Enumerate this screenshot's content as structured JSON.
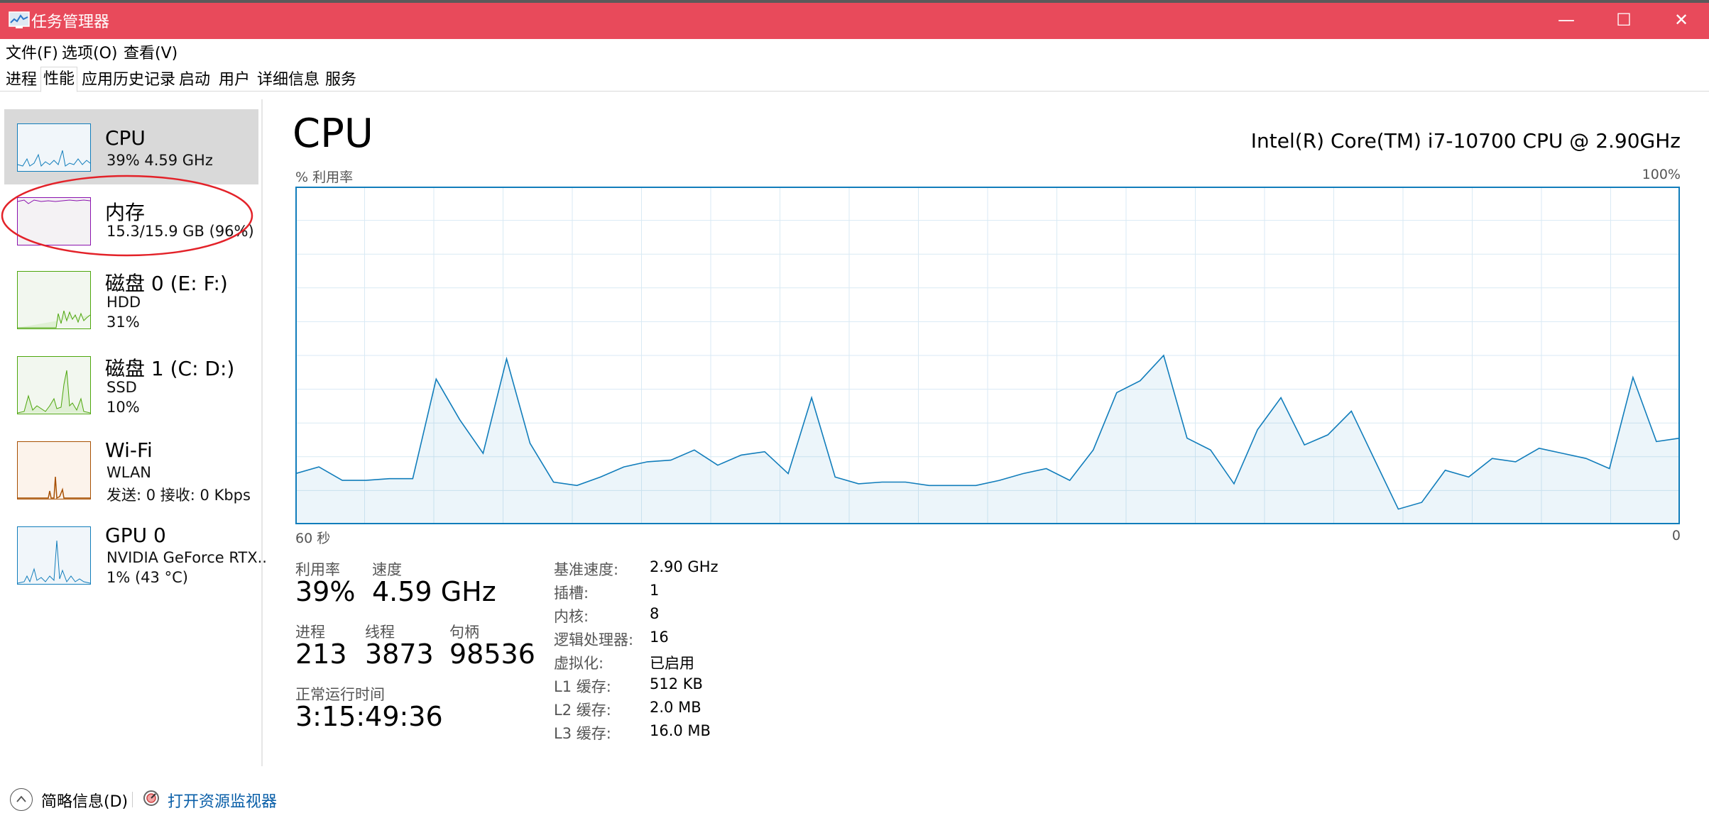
{
  "window": {
    "title": "任务管理器",
    "accent_color": "#e84a5b"
  },
  "window_controls": {
    "minimize": "—",
    "maximize": "☐",
    "close": "✕"
  },
  "menu": [
    "文件(F)",
    "选项(O)",
    "查看(V)"
  ],
  "tabs": [
    {
      "label": "进程"
    },
    {
      "label": "性能",
      "active": true
    },
    {
      "label": "应用历史记录"
    },
    {
      "label": "启动"
    },
    {
      "label": "用户"
    },
    {
      "label": "详细信息"
    },
    {
      "label": "服务"
    }
  ],
  "resources": [
    {
      "title": "CPU",
      "line1": "39%  4.59 GHz",
      "line2": "",
      "active": true,
      "color": "#117dbb"
    },
    {
      "title": "内存",
      "line1": "15.3/15.9 GB (96%)",
      "line2": "",
      "color": "#8b12ae",
      "annotation": "red-ellipse"
    },
    {
      "title": "磁盘 0 (E: F:)",
      "line1": "HDD",
      "line2": "31%",
      "color": "#4da60c"
    },
    {
      "title": "磁盘 1 (C: D:)",
      "line1": "SSD",
      "line2": "10%",
      "color": "#4da60c"
    },
    {
      "title": "Wi-Fi",
      "line1": "WLAN",
      "line2": "发送: 0 接收: 0 Kbps",
      "color": "#a74f01"
    },
    {
      "title": "GPU 0",
      "line1": "NVIDIA GeForce RTX..",
      "line2": "1% (43 °C)",
      "color": "#117dbb"
    }
  ],
  "main": {
    "title": "CPU",
    "cpu_model": "Intel(R) Core(TM) i7-10700 CPU @ 2.90GHz",
    "util_label": "% 利用率",
    "pct_max": "100%",
    "time_left": "60 秒",
    "time_right": "0",
    "graph_color": "#117dbb",
    "graph_values": [
      15,
      17,
      13,
      13,
      13.5,
      13.5,
      43,
      31,
      21,
      49,
      24,
      12.5,
      11.5,
      14,
      17,
      18.5,
      19,
      22,
      17.5,
      20.5,
      21.5,
      15,
      37.5,
      14,
      12,
      12.5,
      12.5,
      11.5,
      11.5,
      11.5,
      13,
      15,
      16.5,
      13,
      22,
      39,
      42.5,
      50,
      25.5,
      22,
      12,
      28,
      37.5,
      23.5,
      26.5,
      33.5,
      19,
      4.5,
      6.5,
      16,
      14,
      19.5,
      18.5,
      22.5,
      21,
      19.5,
      16.5,
      43.5,
      24.5,
      25.5
    ]
  },
  "stats": {
    "utilization": {
      "label": "利用率",
      "value": "39%"
    },
    "speed": {
      "label": "速度",
      "value": "4.59 GHz"
    },
    "processes": {
      "label": "进程",
      "value": "213"
    },
    "threads": {
      "label": "线程",
      "value": "3873"
    },
    "handles": {
      "label": "句柄",
      "value": "98536"
    },
    "uptime": {
      "label": "正常运行时间",
      "value": "3:15:49:36"
    }
  },
  "specs": [
    {
      "label": "基准速度:",
      "value": "2.90 GHz"
    },
    {
      "label": "插槽:",
      "value": "1"
    },
    {
      "label": "内核:",
      "value": "8"
    },
    {
      "label": "逻辑处理器:",
      "value": "16"
    },
    {
      "label": "虚拟化:",
      "value": "已启用"
    },
    {
      "label": "L1 缓存:",
      "value": "512 KB"
    },
    {
      "label": "L2 缓存:",
      "value": "2.0 MB"
    },
    {
      "label": "L3 缓存:",
      "value": "16.0 MB"
    }
  ],
  "footer": {
    "fewer_details": "简略信息(D)",
    "resource_monitor": "打开资源监视器"
  }
}
